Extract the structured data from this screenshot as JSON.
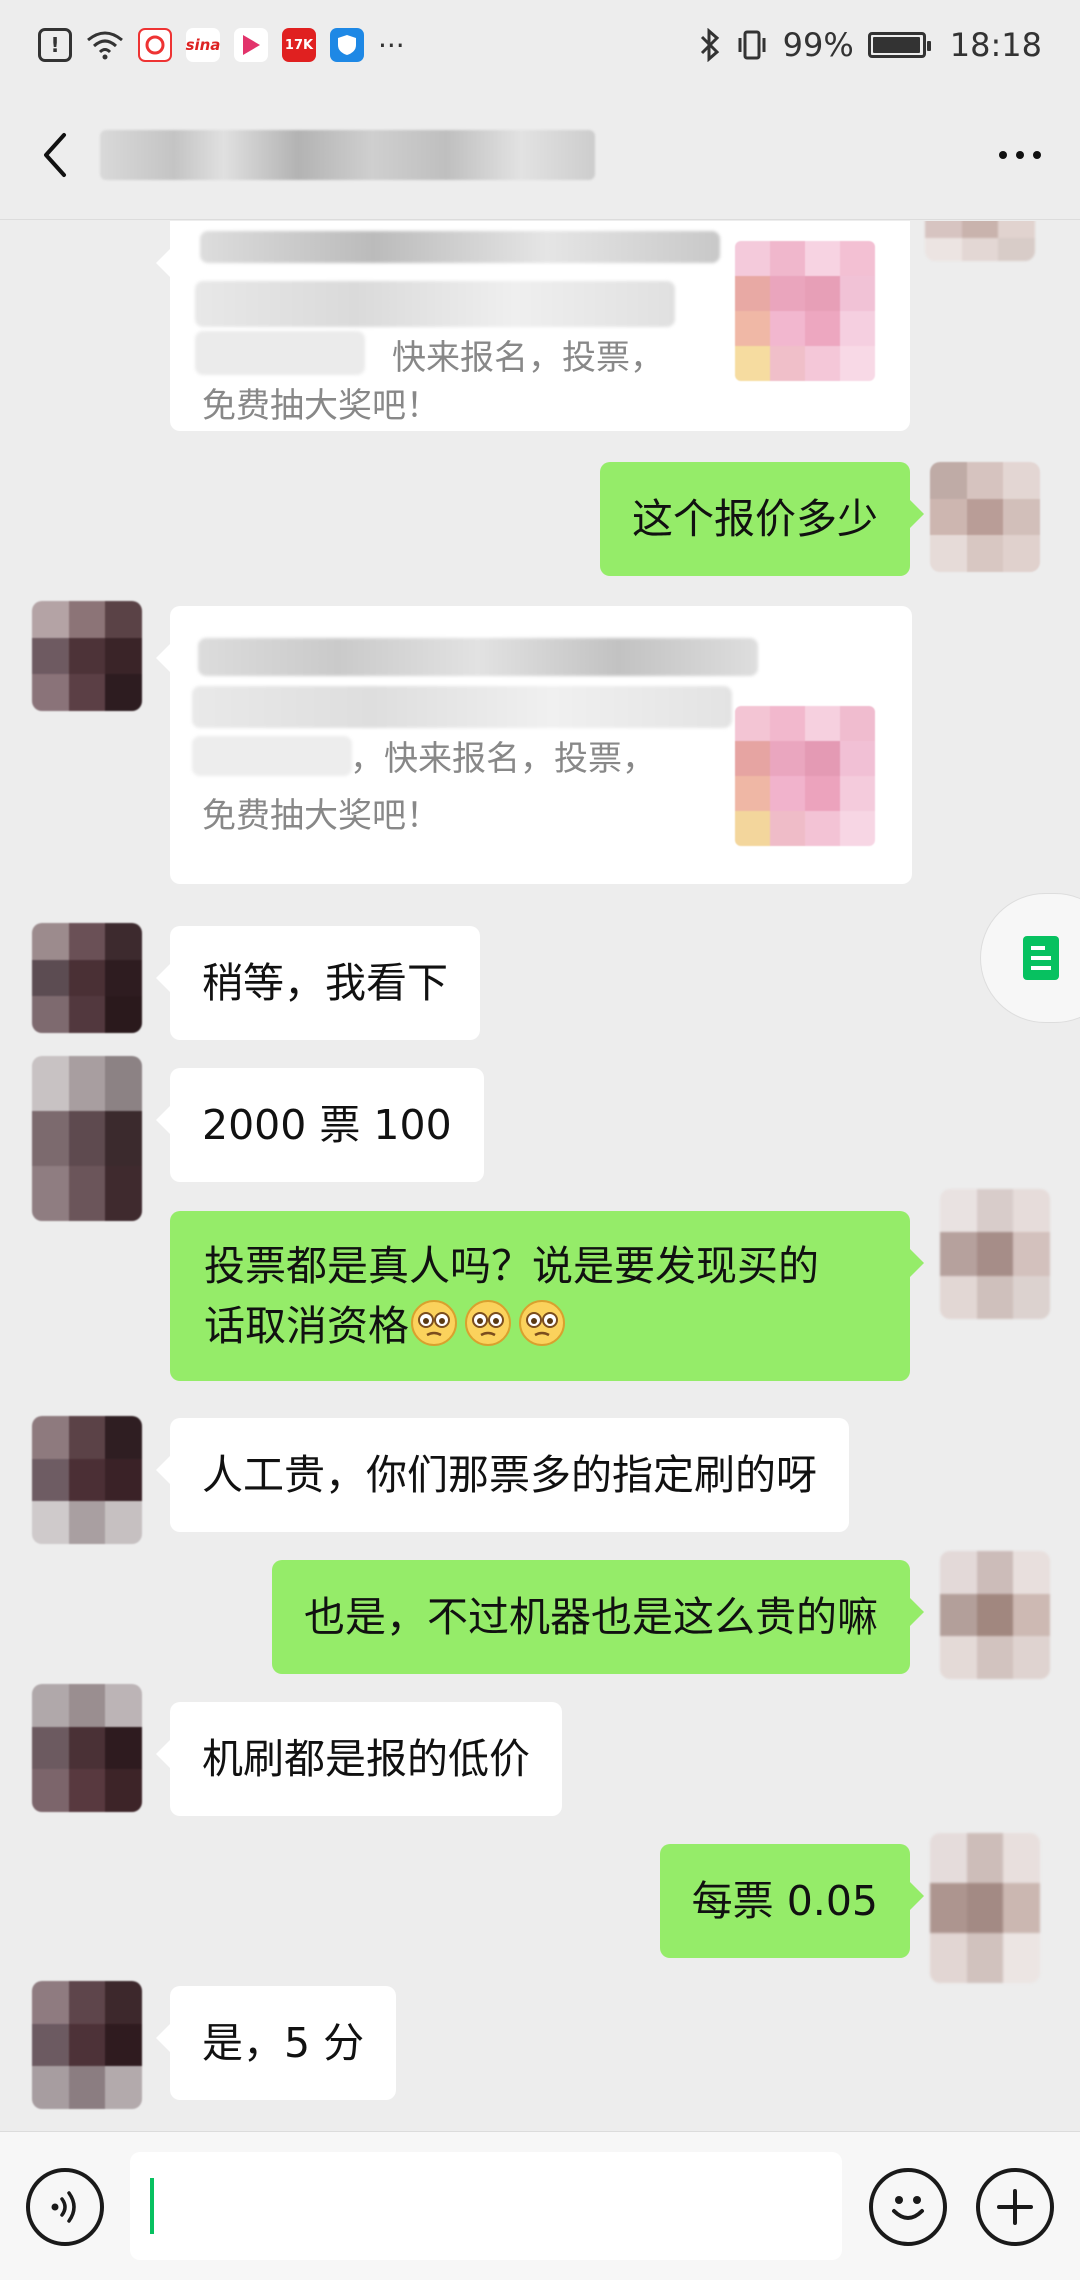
{
  "status_bar": {
    "battery": "99%",
    "time": "18:18",
    "apps": [
      {
        "name": "warning-icon",
        "text": "!"
      },
      {
        "name": "wifi-icon",
        "text": ""
      },
      {
        "name": "weibo-icon",
        "text": ""
      },
      {
        "name": "sina-icon",
        "text": "sina"
      },
      {
        "name": "video-app-icon",
        "text": "Tv"
      },
      {
        "name": "17k-app-icon",
        "text": "17K"
      },
      {
        "name": "shield-app-icon",
        "text": ""
      }
    ],
    "more": "···"
  },
  "header": {
    "title": ""
  },
  "messages": {
    "card1": {
      "line_a": "快来报名，投票，",
      "line_b": "免费抽大奖吧！"
    },
    "m1": "这个报价多少",
    "card2": {
      "line_a": "，快来报名，投票，",
      "line_b": "免费抽大奖吧！"
    },
    "m2": "稍等，我看下",
    "m3": "2000 票 100",
    "m4_line1": "投票都是真人吗？说是要发现买的",
    "m4_line2": "话取消资格",
    "m5": "人工贵，你们那票多的指定刷的呀",
    "m6": "也是，不过机器也是这么贵的嘛",
    "m7": "机刷都是报的低价",
    "m8": "每票 0.05",
    "m9": "是，5 分"
  },
  "colors": {
    "sent_bubble": "#95ec69",
    "received_bubble": "#ffffff",
    "background": "#ededed",
    "accent": "#07c160"
  }
}
